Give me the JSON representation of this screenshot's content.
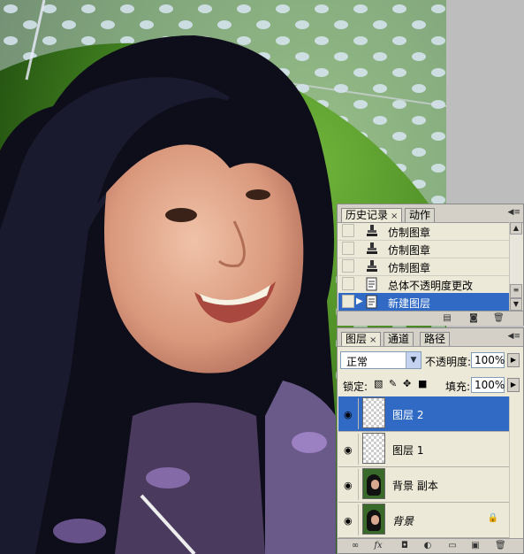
{
  "history_panel": {
    "tabs": [
      {
        "label": "历史记录",
        "close": "×"
      },
      {
        "label": "动作"
      }
    ],
    "items": [
      {
        "label": "仿制图章",
        "icon": "clone-stamp-icon",
        "selected": false
      },
      {
        "label": "仿制图章",
        "icon": "clone-stamp-icon",
        "selected": false
      },
      {
        "label": "仿制图章",
        "icon": "clone-stamp-icon",
        "selected": false
      },
      {
        "label": "总体不透明度更改",
        "icon": "history-state-icon",
        "selected": false
      },
      {
        "label": "新建图层",
        "icon": "history-state-icon",
        "selected": true
      }
    ],
    "bottom_icons": [
      "new-document-from-state-icon",
      "new-snapshot-icon",
      "delete-state-icon"
    ]
  },
  "layers_panel": {
    "tabs": [
      {
        "label": "图层",
        "close": "×"
      },
      {
        "label": "通道"
      },
      {
        "label": "路径"
      }
    ],
    "blend_mode": "正常",
    "opacity_label": "不透明度:",
    "opacity_value": "100%",
    "lock_label": "锁定:",
    "fill_label": "填充:",
    "fill_value": "100%",
    "layers": [
      {
        "name": "图层 2",
        "visible": true,
        "selected": true,
        "thumb": "transparent"
      },
      {
        "name": "图层 1",
        "visible": true,
        "selected": false,
        "thumb": "transparent"
      },
      {
        "name": "背景 副本",
        "visible": true,
        "selected": false,
        "thumb": "photo"
      },
      {
        "name": "背景",
        "visible": true,
        "selected": false,
        "thumb": "photo",
        "locked": true
      }
    ],
    "bottom_icons": [
      "link-layers-icon",
      "layer-style-fx-icon",
      "layer-mask-icon",
      "adjustment-layer-icon",
      "new-group-icon",
      "new-layer-icon",
      "delete-layer-icon"
    ]
  },
  "colors": {
    "selection": "#316ac5",
    "panel_bg": "#ece9d8"
  }
}
